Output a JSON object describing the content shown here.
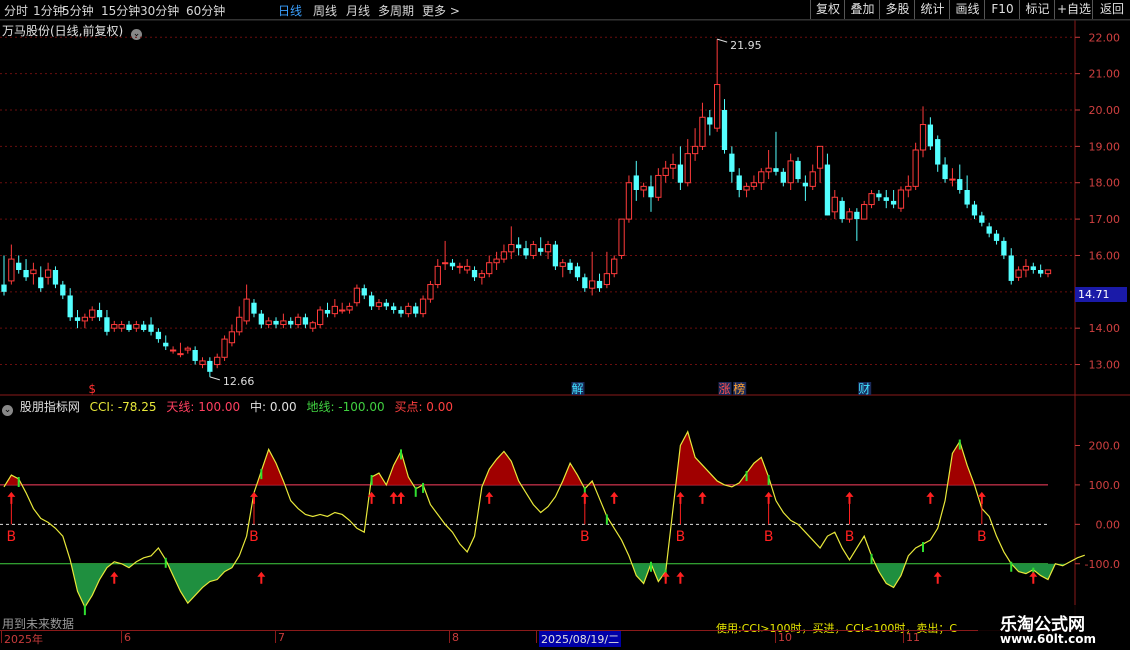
{
  "toolbar": {
    "timeframes": [
      "分时",
      "1分钟",
      "5分钟",
      "15分钟",
      "30分钟",
      "60分钟",
      "日线",
      "周线",
      "月线",
      "多周期",
      "更多 >"
    ],
    "active_index": 6,
    "right_buttons": [
      "复权",
      "叠加",
      "多股",
      "统计",
      "画线",
      "F10",
      "标记",
      "+自选",
      "返回"
    ]
  },
  "main_chart": {
    "title": "万马股份(日线,前复权)",
    "y_ticks": [
      "22.00",
      "21.00",
      "20.00",
      "19.00",
      "18.00",
      "17.00",
      "16.00",
      "15.00",
      "14.00",
      "13.00"
    ],
    "current_price": "14.71",
    "high_label": "21.95",
    "low_label": "12.66",
    "event_markers": [
      {
        "text": "$",
        "color": "#ff3030"
      },
      {
        "text": "解",
        "color": "#40e0ff"
      },
      {
        "text": "涨",
        "color": "#ff5050"
      },
      {
        "text": "榜",
        "color": "#ffa030"
      },
      {
        "text": "财",
        "color": "#40e0ff"
      }
    ]
  },
  "indicator": {
    "name": "股朋指标网",
    "cci_label": "CCI: -78.25",
    "sky_label": "天线: 100.00",
    "mid_label": "中: 0.00",
    "ground_label": "地线: -100.00",
    "buy_label": "买点: 0.00",
    "y_ticks": [
      "200.0",
      "100.0",
      "0.00",
      "-100.0"
    ],
    "buy_letter": "B"
  },
  "time_axis": {
    "labels": [
      "2025年",
      "6",
      "7",
      "8",
      "2025/08/19/二",
      "10",
      "11"
    ],
    "selected": "2025/08/19/二"
  },
  "notes": {
    "future": "用到未来数据",
    "usage": "使用:CCI>100时，买进，CCI<100时，卖出；C"
  },
  "watermark": {
    "line1": "乐淘公式网",
    "line2": "www.60lt.com"
  },
  "colors": {
    "up": "#ff3b3b",
    "down": "#54ffff",
    "cci_line": "#e8e83a",
    "sky": "#ff4060",
    "ground": "#40d040",
    "fill_up": "#a00000",
    "fill_down": "#1f8f3f"
  },
  "chart_data": {
    "type": "candlestick",
    "price_axis": {
      "min": 12.3,
      "max": 22.2
    },
    "cci_axis": {
      "min": -230,
      "max": 290
    },
    "candles": [
      {
        "o": 15.2,
        "h": 16.0,
        "l": 14.9,
        "c": 15.0
      },
      {
        "o": 15.3,
        "h": 16.3,
        "l": 15.2,
        "c": 15.9
      },
      {
        "o": 15.8,
        "h": 16.0,
        "l": 15.5,
        "c": 15.6
      },
      {
        "o": 15.6,
        "h": 15.9,
        "l": 15.3,
        "c": 15.4
      },
      {
        "o": 15.5,
        "h": 15.8,
        "l": 15.2,
        "c": 15.6
      },
      {
        "o": 15.4,
        "h": 15.7,
        "l": 15.0,
        "c": 15.1
      },
      {
        "o": 15.4,
        "h": 15.8,
        "l": 15.2,
        "c": 15.6
      },
      {
        "o": 15.6,
        "h": 15.7,
        "l": 15.1,
        "c": 15.2
      },
      {
        "o": 15.2,
        "h": 15.3,
        "l": 14.8,
        "c": 14.9
      },
      {
        "o": 14.9,
        "h": 15.1,
        "l": 14.2,
        "c": 14.3
      },
      {
        "o": 14.3,
        "h": 14.5,
        "l": 14.0,
        "c": 14.2
      },
      {
        "o": 14.2,
        "h": 14.4,
        "l": 14.0,
        "c": 14.3
      },
      {
        "o": 14.3,
        "h": 14.6,
        "l": 14.2,
        "c": 14.5
      },
      {
        "o": 14.5,
        "h": 14.7,
        "l": 14.2,
        "c": 14.3
      },
      {
        "o": 14.3,
        "h": 14.5,
        "l": 13.8,
        "c": 13.9
      },
      {
        "o": 14.0,
        "h": 14.2,
        "l": 13.9,
        "c": 14.1
      },
      {
        "o": 14.0,
        "h": 14.2,
        "l": 13.9,
        "c": 14.1
      },
      {
        "o": 14.1,
        "h": 14.2,
        "l": 13.9,
        "c": 13.95
      },
      {
        "o": 14.0,
        "h": 14.2,
        "l": 13.9,
        "c": 14.1
      },
      {
        "o": 14.1,
        "h": 14.2,
        "l": 13.9,
        "c": 13.95
      },
      {
        "o": 14.1,
        "h": 14.3,
        "l": 13.8,
        "c": 13.9
      },
      {
        "o": 13.9,
        "h": 14.0,
        "l": 13.6,
        "c": 13.7
      },
      {
        "o": 13.6,
        "h": 13.8,
        "l": 13.4,
        "c": 13.5
      },
      {
        "o": 13.4,
        "h": 13.5,
        "l": 13.3,
        "c": 13.4
      },
      {
        "o": 13.3,
        "h": 13.6,
        "l": 13.2,
        "c": 13.3
      },
      {
        "o": 13.4,
        "h": 13.5,
        "l": 13.3,
        "c": 13.45
      },
      {
        "o": 13.4,
        "h": 13.5,
        "l": 13.0,
        "c": 13.1
      },
      {
        "o": 13.0,
        "h": 13.2,
        "l": 12.9,
        "c": 13.1
      },
      {
        "o": 13.1,
        "h": 13.2,
        "l": 12.66,
        "c": 12.8
      },
      {
        "o": 13.0,
        "h": 13.3,
        "l": 12.9,
        "c": 13.2
      },
      {
        "o": 13.2,
        "h": 13.8,
        "l": 13.1,
        "c": 13.7
      },
      {
        "o": 13.6,
        "h": 14.1,
        "l": 13.5,
        "c": 13.9
      },
      {
        "o": 13.9,
        "h": 14.6,
        "l": 13.8,
        "c": 14.3
      },
      {
        "o": 14.2,
        "h": 15.2,
        "l": 14.1,
        "c": 14.8
      },
      {
        "o": 14.7,
        "h": 14.8,
        "l": 14.3,
        "c": 14.4
      },
      {
        "o": 14.4,
        "h": 14.5,
        "l": 14.0,
        "c": 14.1
      },
      {
        "o": 14.1,
        "h": 14.3,
        "l": 14.0,
        "c": 14.2
      },
      {
        "o": 14.2,
        "h": 14.3,
        "l": 14.0,
        "c": 14.1
      },
      {
        "o": 14.1,
        "h": 14.4,
        "l": 14.0,
        "c": 14.2
      },
      {
        "o": 14.2,
        "h": 14.3,
        "l": 14.0,
        "c": 14.1
      },
      {
        "o": 14.1,
        "h": 14.4,
        "l": 14.0,
        "c": 14.3
      },
      {
        "o": 14.3,
        "h": 14.4,
        "l": 14.0,
        "c": 14.1
      },
      {
        "o": 14.0,
        "h": 14.2,
        "l": 13.9,
        "c": 14.15
      },
      {
        "o": 14.1,
        "h": 14.6,
        "l": 14.0,
        "c": 14.5
      },
      {
        "o": 14.5,
        "h": 14.7,
        "l": 14.3,
        "c": 14.4
      },
      {
        "o": 14.4,
        "h": 14.8,
        "l": 14.3,
        "c": 14.6
      },
      {
        "o": 14.5,
        "h": 14.7,
        "l": 14.4,
        "c": 14.5
      },
      {
        "o": 14.5,
        "h": 14.7,
        "l": 14.4,
        "c": 14.6
      },
      {
        "o": 14.7,
        "h": 15.2,
        "l": 14.6,
        "c": 15.1
      },
      {
        "o": 15.1,
        "h": 15.2,
        "l": 14.8,
        "c": 14.9
      },
      {
        "o": 14.9,
        "h": 15.0,
        "l": 14.5,
        "c": 14.6
      },
      {
        "o": 14.6,
        "h": 14.8,
        "l": 14.5,
        "c": 14.7
      },
      {
        "o": 14.7,
        "h": 14.8,
        "l": 14.5,
        "c": 14.6
      },
      {
        "o": 14.6,
        "h": 14.7,
        "l": 14.4,
        "c": 14.5
      },
      {
        "o": 14.5,
        "h": 14.6,
        "l": 14.3,
        "c": 14.4
      },
      {
        "o": 14.4,
        "h": 14.7,
        "l": 14.3,
        "c": 14.6
      },
      {
        "o": 14.6,
        "h": 14.7,
        "l": 14.3,
        "c": 14.4
      },
      {
        "o": 14.4,
        "h": 14.9,
        "l": 14.3,
        "c": 14.8
      },
      {
        "o": 14.8,
        "h": 15.3,
        "l": 14.7,
        "c": 15.2
      },
      {
        "o": 15.2,
        "h": 15.9,
        "l": 15.1,
        "c": 15.7
      },
      {
        "o": 15.8,
        "h": 16.4,
        "l": 15.6,
        "c": 15.8
      },
      {
        "o": 15.8,
        "h": 15.9,
        "l": 15.6,
        "c": 15.7
      },
      {
        "o": 15.7,
        "h": 15.8,
        "l": 15.5,
        "c": 15.7
      },
      {
        "o": 15.6,
        "h": 15.9,
        "l": 15.5,
        "c": 15.7
      },
      {
        "o": 15.6,
        "h": 15.7,
        "l": 15.3,
        "c": 15.4
      },
      {
        "o": 15.4,
        "h": 15.6,
        "l": 15.2,
        "c": 15.5
      },
      {
        "o": 15.5,
        "h": 16.0,
        "l": 15.4,
        "c": 15.8
      },
      {
        "o": 15.8,
        "h": 16.1,
        "l": 15.6,
        "c": 15.9
      },
      {
        "o": 15.9,
        "h": 16.3,
        "l": 15.8,
        "c": 16.1
      },
      {
        "o": 16.1,
        "h": 16.8,
        "l": 15.9,
        "c": 16.3
      },
      {
        "o": 16.3,
        "h": 16.5,
        "l": 16.0,
        "c": 16.2
      },
      {
        "o": 16.2,
        "h": 16.4,
        "l": 15.9,
        "c": 16.0
      },
      {
        "o": 16.0,
        "h": 16.4,
        "l": 15.9,
        "c": 16.3
      },
      {
        "o": 16.2,
        "h": 16.5,
        "l": 16.0,
        "c": 16.1
      },
      {
        "o": 16.1,
        "h": 16.4,
        "l": 15.9,
        "c": 16.3
      },
      {
        "o": 16.3,
        "h": 16.4,
        "l": 15.6,
        "c": 15.7
      },
      {
        "o": 15.7,
        "h": 15.9,
        "l": 15.4,
        "c": 15.8
      },
      {
        "o": 15.8,
        "h": 15.9,
        "l": 15.5,
        "c": 15.6
      },
      {
        "o": 15.7,
        "h": 15.8,
        "l": 15.3,
        "c": 15.4
      },
      {
        "o": 15.4,
        "h": 15.5,
        "l": 15.0,
        "c": 15.1
      },
      {
        "o": 15.1,
        "h": 16.1,
        "l": 14.9,
        "c": 15.3
      },
      {
        "o": 15.3,
        "h": 15.5,
        "l": 15.0,
        "c": 15.1
      },
      {
        "o": 15.2,
        "h": 16.1,
        "l": 15.1,
        "c": 15.5
      },
      {
        "o": 15.5,
        "h": 16.0,
        "l": 15.4,
        "c": 15.9
      },
      {
        "o": 16.0,
        "h": 17.0,
        "l": 15.9,
        "c": 17.0
      },
      {
        "o": 17.0,
        "h": 18.2,
        "l": 16.9,
        "c": 18.0
      },
      {
        "o": 18.2,
        "h": 18.6,
        "l": 17.5,
        "c": 17.8
      },
      {
        "o": 17.8,
        "h": 18.0,
        "l": 17.6,
        "c": 17.9
      },
      {
        "o": 17.9,
        "h": 18.2,
        "l": 17.2,
        "c": 17.6
      },
      {
        "o": 17.6,
        "h": 18.4,
        "l": 17.5,
        "c": 18.2
      },
      {
        "o": 18.2,
        "h": 18.6,
        "l": 18.0,
        "c": 18.4
      },
      {
        "o": 18.4,
        "h": 18.8,
        "l": 18.1,
        "c": 18.5
      },
      {
        "o": 18.5,
        "h": 19.0,
        "l": 17.8,
        "c": 18.0
      },
      {
        "o": 18.0,
        "h": 19.2,
        "l": 17.9,
        "c": 18.8
      },
      {
        "o": 18.8,
        "h": 19.5,
        "l": 18.6,
        "c": 19.0
      },
      {
        "o": 19.0,
        "h": 20.2,
        "l": 18.9,
        "c": 19.8
      },
      {
        "o": 19.8,
        "h": 20.0,
        "l": 19.3,
        "c": 19.6
      },
      {
        "o": 19.5,
        "h": 21.95,
        "l": 19.4,
        "c": 20.7
      },
      {
        "o": 20.0,
        "h": 20.3,
        "l": 18.8,
        "c": 18.9
      },
      {
        "o": 18.8,
        "h": 19.0,
        "l": 18.0,
        "c": 18.3
      },
      {
        "o": 18.2,
        "h": 18.4,
        "l": 17.6,
        "c": 17.8
      },
      {
        "o": 17.8,
        "h": 18.0,
        "l": 17.6,
        "c": 17.9
      },
      {
        "o": 17.9,
        "h": 18.2,
        "l": 17.8,
        "c": 18.0
      },
      {
        "o": 18.0,
        "h": 18.4,
        "l": 17.8,
        "c": 18.3
      },
      {
        "o": 18.3,
        "h": 18.9,
        "l": 18.1,
        "c": 18.4
      },
      {
        "o": 18.4,
        "h": 19.4,
        "l": 18.2,
        "c": 18.3
      },
      {
        "o": 18.3,
        "h": 18.4,
        "l": 17.9,
        "c": 18.0
      },
      {
        "o": 18.0,
        "h": 18.8,
        "l": 17.8,
        "c": 18.6
      },
      {
        "o": 18.6,
        "h": 18.7,
        "l": 18.0,
        "c": 18.1
      },
      {
        "o": 18.0,
        "h": 18.2,
        "l": 17.5,
        "c": 17.9
      },
      {
        "o": 17.9,
        "h": 18.5,
        "l": 17.8,
        "c": 18.3
      },
      {
        "o": 18.4,
        "h": 19.0,
        "l": 18.0,
        "c": 19.0
      },
      {
        "o": 18.5,
        "h": 18.8,
        "l": 17.1,
        "c": 17.1
      },
      {
        "o": 17.2,
        "h": 17.8,
        "l": 17.0,
        "c": 17.6
      },
      {
        "o": 17.5,
        "h": 17.6,
        "l": 16.9,
        "c": 17.0
      },
      {
        "o": 17.0,
        "h": 17.3,
        "l": 16.9,
        "c": 17.2
      },
      {
        "o": 17.2,
        "h": 17.3,
        "l": 16.4,
        "c": 17.0
      },
      {
        "o": 17.0,
        "h": 17.5,
        "l": 17.0,
        "c": 17.4
      },
      {
        "o": 17.4,
        "h": 17.8,
        "l": 17.3,
        "c": 17.7
      },
      {
        "o": 17.7,
        "h": 17.8,
        "l": 17.5,
        "c": 17.6
      },
      {
        "o": 17.6,
        "h": 17.8,
        "l": 17.3,
        "c": 17.5
      },
      {
        "o": 17.5,
        "h": 17.8,
        "l": 17.3,
        "c": 17.4
      },
      {
        "o": 17.3,
        "h": 17.9,
        "l": 17.2,
        "c": 17.8
      },
      {
        "o": 17.8,
        "h": 18.2,
        "l": 17.6,
        "c": 17.9
      },
      {
        "o": 17.9,
        "h": 19.1,
        "l": 17.8,
        "c": 18.9
      },
      {
        "o": 18.9,
        "h": 20.1,
        "l": 18.7,
        "c": 19.6
      },
      {
        "o": 19.6,
        "h": 19.8,
        "l": 18.9,
        "c": 19.0
      },
      {
        "o": 19.2,
        "h": 19.3,
        "l": 18.3,
        "c": 18.5
      },
      {
        "o": 18.5,
        "h": 18.7,
        "l": 18.0,
        "c": 18.1
      },
      {
        "o": 18.1,
        "h": 18.4,
        "l": 17.9,
        "c": 18.1
      },
      {
        "o": 18.1,
        "h": 18.5,
        "l": 17.7,
        "c": 17.8
      },
      {
        "o": 17.8,
        "h": 18.2,
        "l": 17.3,
        "c": 17.4
      },
      {
        "o": 17.4,
        "h": 17.5,
        "l": 17.0,
        "c": 17.1
      },
      {
        "o": 17.1,
        "h": 17.2,
        "l": 16.8,
        "c": 16.9
      },
      {
        "o": 16.8,
        "h": 16.9,
        "l": 16.5,
        "c": 16.6
      },
      {
        "o": 16.6,
        "h": 16.7,
        "l": 16.3,
        "c": 16.4
      },
      {
        "o": 16.4,
        "h": 16.5,
        "l": 15.9,
        "c": 16.0
      },
      {
        "o": 16.0,
        "h": 16.2,
        "l": 15.2,
        "c": 15.3
      },
      {
        "o": 15.4,
        "h": 15.7,
        "l": 15.3,
        "c": 15.6
      },
      {
        "o": 15.6,
        "h": 15.9,
        "l": 15.4,
        "c": 15.7
      },
      {
        "o": 15.7,
        "h": 15.8,
        "l": 15.5,
        "c": 15.6
      },
      {
        "o": 15.6,
        "h": 15.75,
        "l": 15.4,
        "c": 15.5
      },
      {
        "o": 15.5,
        "h": 15.6,
        "l": 15.4,
        "c": 15.6
      }
    ],
    "cci": [
      95,
      125,
      115,
      80,
      40,
      15,
      5,
      -10,
      -30,
      -90,
      -170,
      -210,
      -180,
      -140,
      -110,
      -95,
      -100,
      -110,
      -95,
      -85,
      -80,
      -60,
      -90,
      -130,
      -170,
      -200,
      -180,
      -160,
      -145,
      -140,
      -120,
      -110,
      -80,
      -30,
      80,
      135,
      190,
      155,
      110,
      60,
      40,
      25,
      20,
      25,
      20,
      30,
      25,
      10,
      -10,
      -20,
      120,
      130,
      100,
      150,
      185,
      120,
      90,
      100,
      50,
      25,
      0,
      -20,
      -50,
      -70,
      -30,
      95,
      140,
      165,
      185,
      160,
      110,
      80,
      50,
      30,
      45,
      70,
      110,
      155,
      125,
      90,
      110,
      65,
      20,
      -10,
      -40,
      -80,
      -130,
      -150,
      -100,
      -145,
      -120,
      40,
      200,
      235,
      170,
      150,
      130,
      110,
      100,
      95,
      105,
      130,
      155,
      170,
      120,
      60,
      30,
      10,
      0,
      -20,
      -40,
      -60,
      -30,
      -20,
      -60,
      -90,
      -60,
      -30,
      -80,
      -120,
      -150,
      -160,
      -130,
      -80,
      -60,
      -50,
      -40,
      -10,
      60,
      180,
      210,
      150,
      100,
      40,
      20,
      -30,
      -70,
      -100,
      -120,
      -125,
      -115,
      -130,
      -140,
      -100,
      -105,
      -95,
      -85,
      -78.25
    ],
    "sky_value": 100,
    "mid_value": 0,
    "ground_value": -100,
    "buy_indices": [
      1,
      34,
      50,
      53,
      54,
      66,
      79,
      83,
      92,
      95,
      104,
      115,
      126,
      133
    ],
    "buy_b_indices": [
      1,
      34,
      79,
      92,
      104,
      115,
      133
    ],
    "ground_arrow_indices": [
      15,
      35,
      90,
      92,
      127,
      140
    ],
    "green_tick_indices": [
      2,
      11,
      22,
      35,
      50,
      54,
      56,
      57,
      79,
      82,
      88,
      90,
      101,
      104,
      118,
      125,
      130,
      137,
      140
    ],
    "event_indices": [
      12,
      78,
      98,
      100,
      117
    ]
  }
}
